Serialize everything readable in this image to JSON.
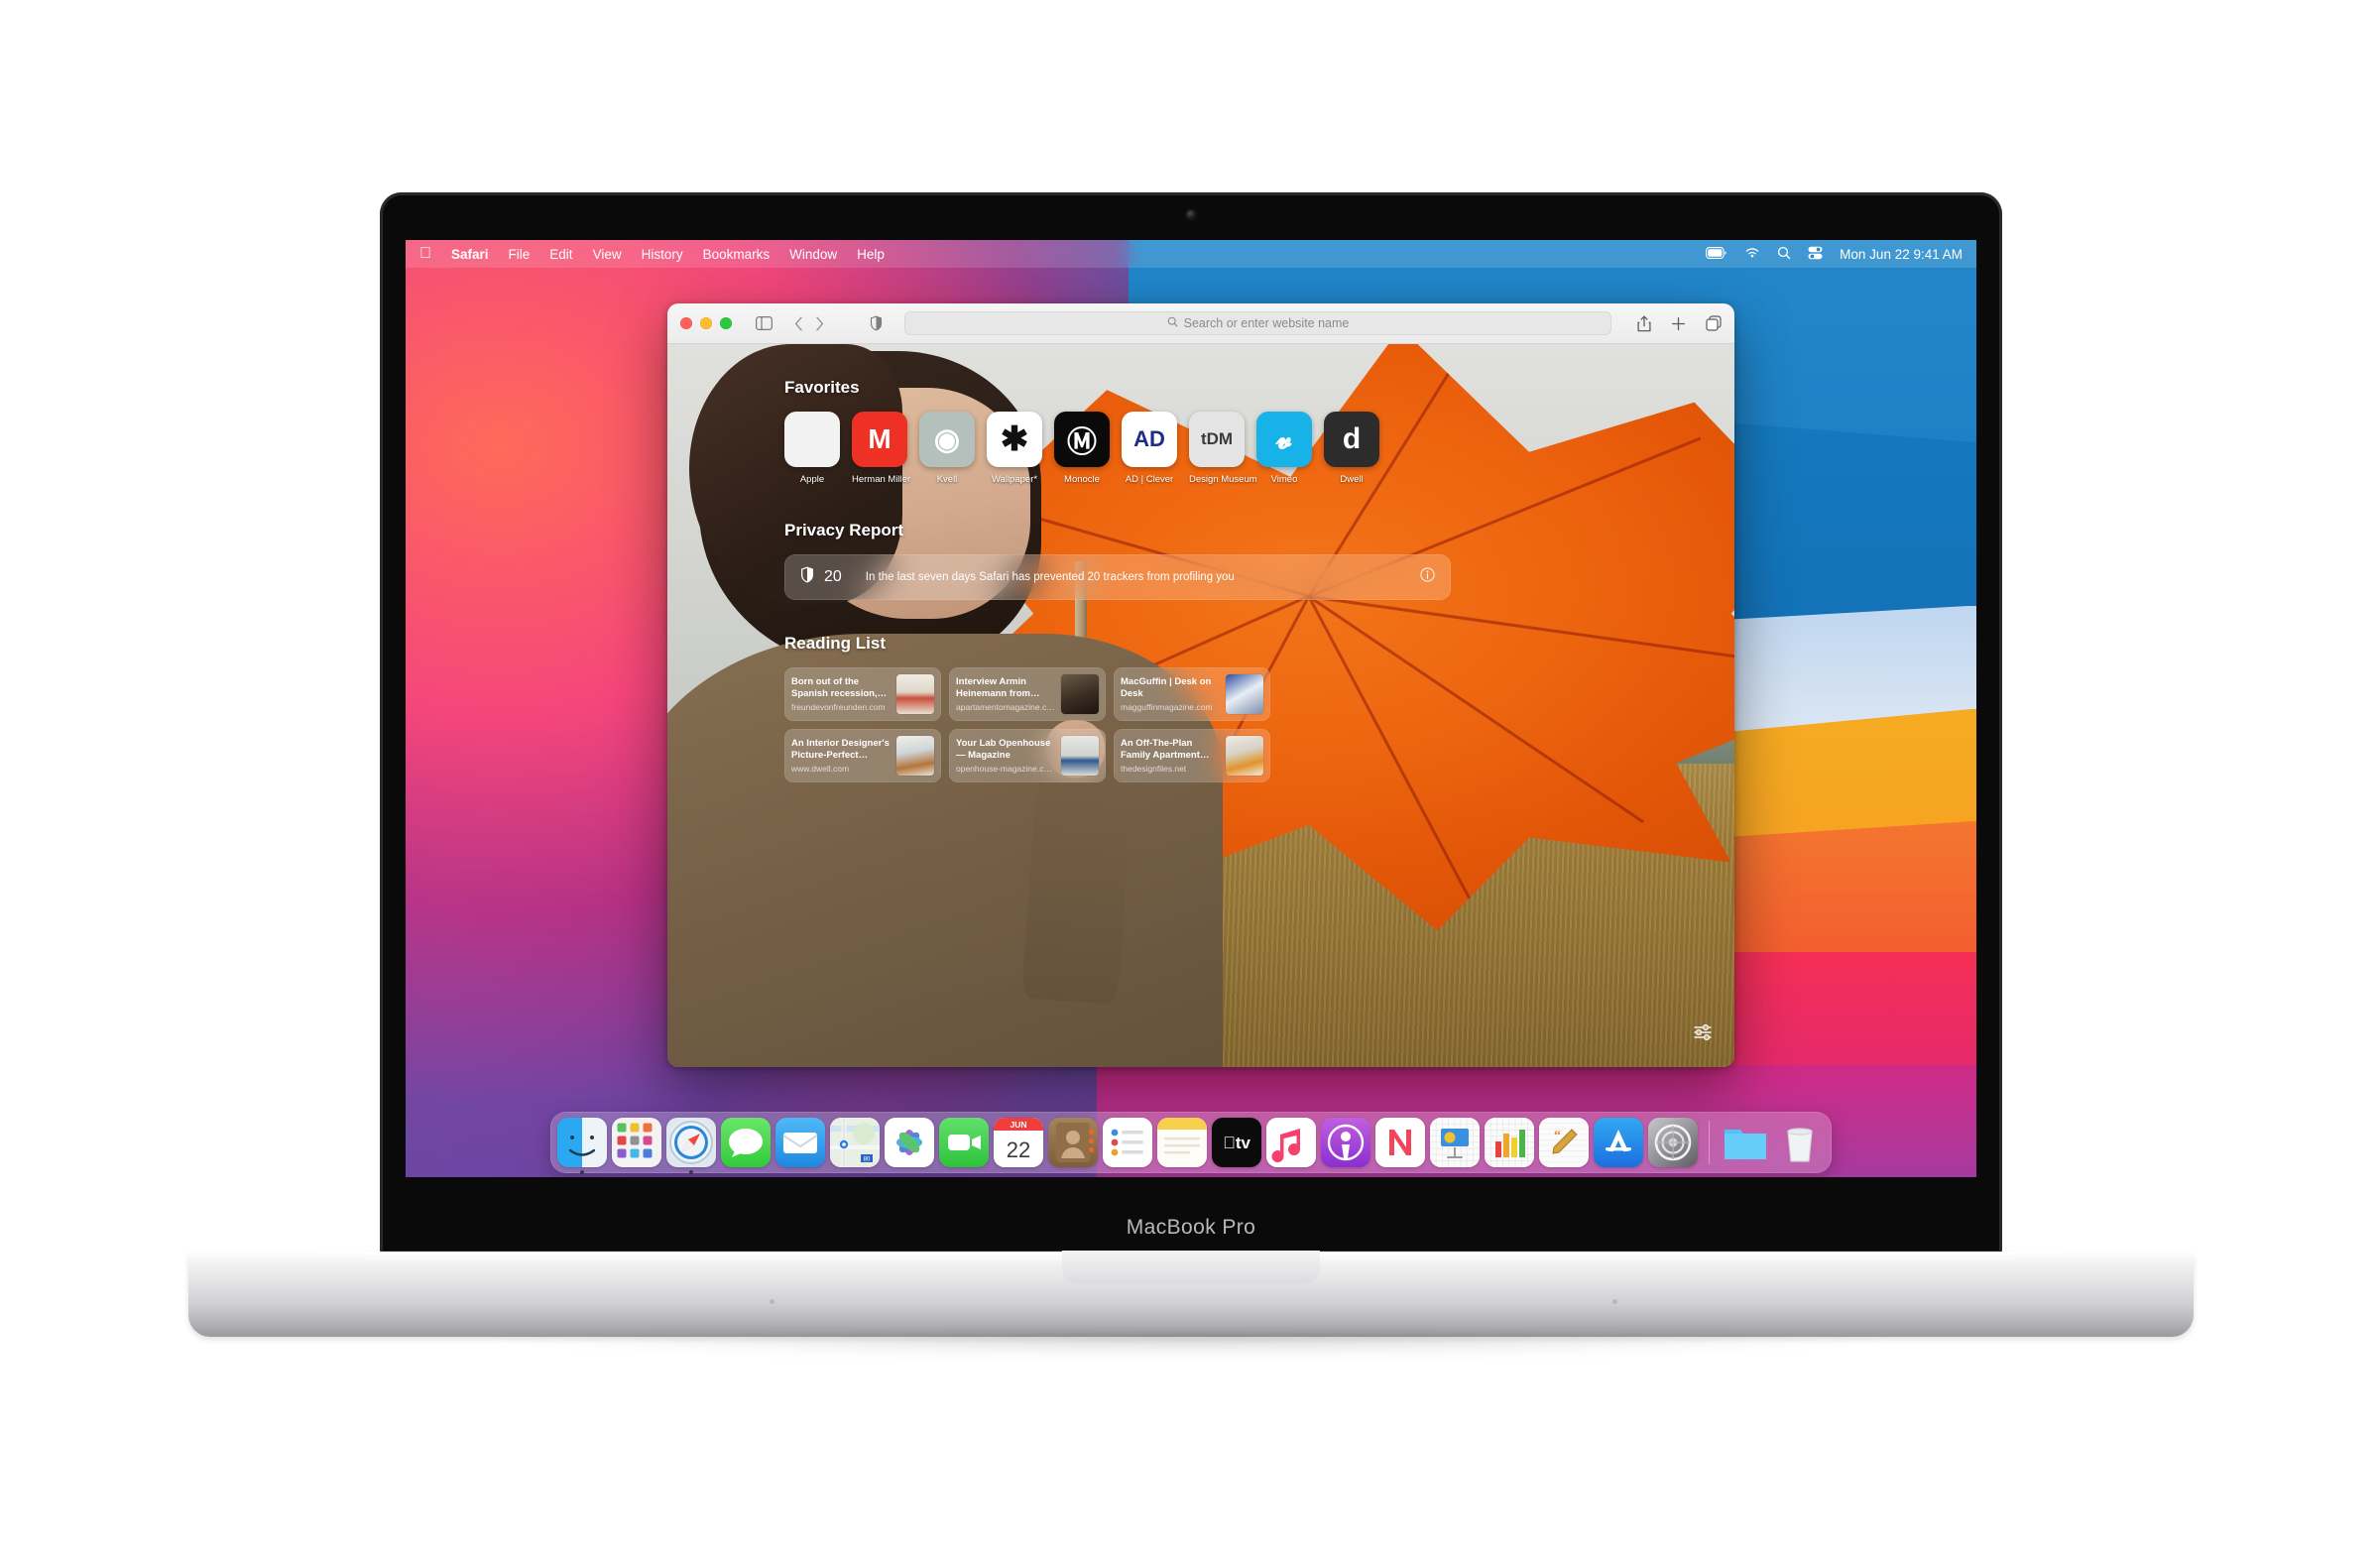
{
  "device": {
    "model_label": "MacBook Pro"
  },
  "menubar": {
    "apple_icon": "apple-logo-icon",
    "items": [
      "Safari",
      "File",
      "Edit",
      "View",
      "History",
      "Bookmarks",
      "Window",
      "Help"
    ],
    "status_icons": [
      "battery-icon",
      "wifi-icon",
      "search-icon",
      "control-center-icon"
    ],
    "clock": "Mon Jun 22  9:41 AM"
  },
  "safari": {
    "window_buttons": [
      "close-button",
      "minimize-button",
      "zoom-button"
    ],
    "toolbar": {
      "sidebar_icon": "sidebar-icon",
      "back_icon": "chevron-left-icon",
      "forward_icon": "chevron-right-icon",
      "privacy_shield_icon": "privacy-shield-icon",
      "search_placeholder": "Search or enter website name",
      "search_value": "",
      "search_icon": "search-icon",
      "share_icon": "share-icon",
      "new_tab_icon": "plus-icon",
      "tab_overview_icon": "tab-overview-icon"
    },
    "start_page": {
      "favorites": {
        "title": "Favorites",
        "items": [
          {
            "label": "Apple",
            "glyph": "",
            "bg": "#f2f2f2",
            "fg": "#5a5a5a",
            "size": 30
          },
          {
            "label": "Herman Miller",
            "glyph": "M",
            "bg": "#ee3124",
            "fg": "#ffffff",
            "size": 28
          },
          {
            "label": "Kvell",
            "glyph": "◉",
            "bg": "#b4c0bb",
            "fg": "#ffffff",
            "size": 30
          },
          {
            "label": "Wallpaper*",
            "glyph": "✱",
            "bg": "#ffffff",
            "fg": "#111111",
            "size": 34
          },
          {
            "label": "Monocle",
            "glyph": "Ⓜ",
            "bg": "#0a0a0a",
            "fg": "#ffffff",
            "size": 30
          },
          {
            "label": "AD | Clever",
            "glyph": "AD",
            "bg": "#ffffff",
            "fg": "#1f2d87",
            "size": 22
          },
          {
            "label": "Design Museum",
            "glyph": "tDM",
            "bg": "#e4e4e4",
            "fg": "#3a3a3a",
            "size": 17
          },
          {
            "label": "Vimeo",
            "glyph": "𝓿",
            "bg": "#17b3e8",
            "fg": "#ffffff",
            "size": 30
          },
          {
            "label": "Dwell",
            "glyph": "d",
            "bg": "#2c2c2c",
            "fg": "#ffffff",
            "size": 30
          }
        ]
      },
      "privacy_report": {
        "title": "Privacy Report",
        "shield_icon": "shield-icon",
        "tracker_count": "20",
        "message": "In the last seven days Safari has prevented 20 trackers from profiling you",
        "info_icon": "info-icon"
      },
      "reading_list": {
        "title": "Reading List",
        "items": [
          {
            "title": "Born out of the Spanish recession, the architec…",
            "url": "freundevonfreunden.com",
            "thumb": "interior-shelves-thumb"
          },
          {
            "title": "Interview Armin Heinemann from Paula…",
            "url": "apartamentomagazine.c…",
            "thumb": "portrait-dark-thumb"
          },
          {
            "title": "MacGuffin | Desk on Desk",
            "url": "magguffinmagazine.com",
            "thumb": "blue-desk-thumb"
          },
          {
            "title": "An Interior Designer's Picture-Perfect Brookl…",
            "url": "www.dwell.com",
            "thumb": "living-room-thumb"
          },
          {
            "title": "Your Lab Openhouse — Magazine",
            "url": "openhouse-magazine.c…",
            "thumb": "people-dancing-thumb"
          },
          {
            "title": "An Off-The-Plan Family Apartment Unlike Any…",
            "url": "thedesignfiles.net",
            "thumb": "kitchen-shelf-thumb"
          }
        ]
      },
      "settings_icon": "start-page-settings-icon"
    }
  },
  "dock": {
    "items": [
      {
        "name": "finder",
        "label": "Finder",
        "running": true
      },
      {
        "name": "launchpad",
        "label": "Launchpad",
        "running": false
      },
      {
        "name": "safari",
        "label": "Safari",
        "running": true
      },
      {
        "name": "messages",
        "label": "Messages",
        "running": false
      },
      {
        "name": "mail",
        "label": "Mail",
        "running": false
      },
      {
        "name": "maps",
        "label": "Maps",
        "running": false
      },
      {
        "name": "photos",
        "label": "Photos",
        "running": false
      },
      {
        "name": "facetime",
        "label": "FaceTime",
        "running": false
      },
      {
        "name": "calendar",
        "label": "Calendar",
        "running": false
      },
      {
        "name": "contacts",
        "label": "Contacts",
        "running": false
      },
      {
        "name": "reminders",
        "label": "Reminders",
        "running": false
      },
      {
        "name": "notes",
        "label": "Notes",
        "running": false
      },
      {
        "name": "appletv",
        "label": "Apple TV",
        "running": false
      },
      {
        "name": "music",
        "label": "Music",
        "running": false
      },
      {
        "name": "podcasts",
        "label": "Podcasts",
        "running": false
      },
      {
        "name": "news",
        "label": "News",
        "running": false
      },
      {
        "name": "keynote",
        "label": "Keynote",
        "running": false
      },
      {
        "name": "numbers",
        "label": "Numbers",
        "running": false
      },
      {
        "name": "pages",
        "label": "Pages",
        "running": false
      },
      {
        "name": "appstore",
        "label": "App Store",
        "running": false
      },
      {
        "name": "systempreferences",
        "label": "System Preferences",
        "running": false
      }
    ],
    "separator": true,
    "trailing": [
      {
        "name": "downloads-folder",
        "label": "Downloads"
      },
      {
        "name": "trash",
        "label": "Trash"
      }
    ],
    "calendar": {
      "month": "JUN",
      "day": "22"
    }
  },
  "colors": {
    "accent_orange": "#f5781f",
    "wallpaper_blue": "#1a7fc4",
    "wallpaper_pink": "#f5145f",
    "wallpaper_purple": "#7b4aa8"
  }
}
